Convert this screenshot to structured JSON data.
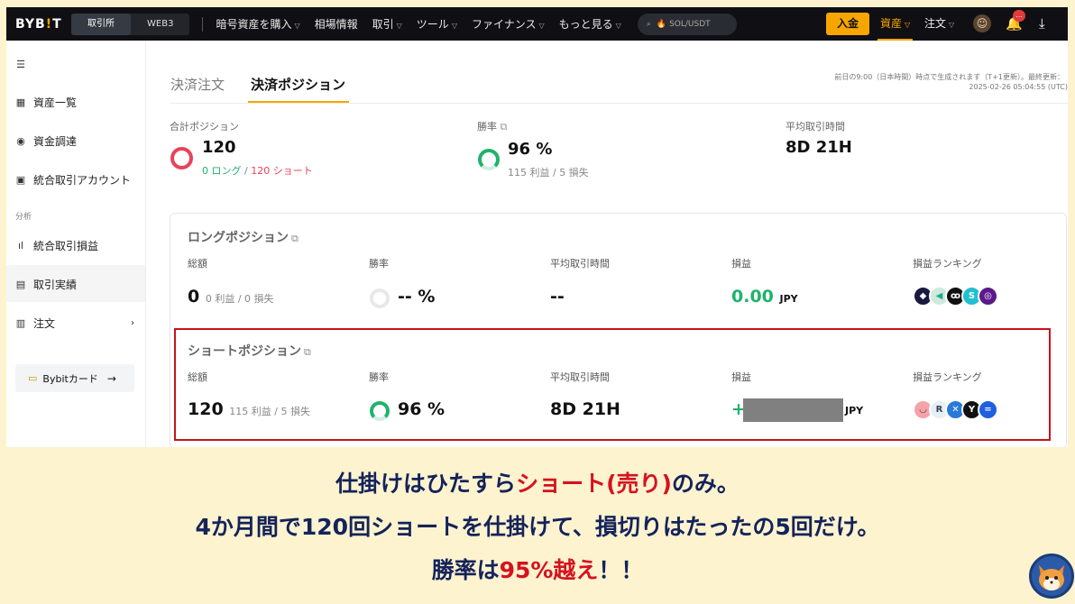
{
  "header": {
    "logo": "BYBIT",
    "seg": [
      "取引所",
      "WEB3"
    ],
    "nav": [
      "暗号資産を購入",
      "相場情報",
      "取引",
      "ツール",
      "ファイナンス",
      "もっと見る"
    ],
    "search_placeholder": "SOL/USDT",
    "deposit": "入金",
    "assets": "資産",
    "orders": "注文",
    "badge": "..."
  },
  "sidebar": {
    "items": [
      "資産一覧",
      "資金調達",
      "統合取引アカウント"
    ],
    "section": "分析",
    "items2": [
      "統合取引損益",
      "取引実績",
      "注文"
    ],
    "card_button": "Bybitカード"
  },
  "tabs": [
    "決済注文",
    "決済ポジション"
  ],
  "update_note": "前日の9:00（日本時間）時点で生成されます（T+1更新）。最終更新：",
  "update_time": "2025-02-26 05:04:55 (UTC)",
  "summary": {
    "total_label": "合計ポジション",
    "total_value": "120",
    "long_part": "0 ロング",
    "short_part": "120 ショート",
    "winrate_label": "勝率",
    "winrate_value": "96 %",
    "winrate_sub": "115 利益 / 5 損失",
    "avg_label": "平均取引時間",
    "avg_value": "8D 21H"
  },
  "long": {
    "title": "ロングポジション",
    "cols": [
      "総額",
      "勝率",
      "平均取引時間",
      "損益",
      "損益ランキング"
    ],
    "total": "0",
    "total_sub": "0 利益 / 0 損失",
    "winrate": "-- %",
    "avg": "--",
    "pnl": "0.00",
    "pnl_unit": "JPY"
  },
  "short": {
    "title": "ショートポジション",
    "cols": [
      "総額",
      "勝率",
      "平均取引時間",
      "損益",
      "損益ランキング"
    ],
    "total": "120",
    "total_sub": "115 利益 / 5 損失",
    "winrate": "96 %",
    "avg": "8D 21H",
    "pnl_sign": "+",
    "pnl_unit": "JPY"
  },
  "caption": {
    "l1a": "仕掛けはひたすら",
    "l1b": "ショート(売り)",
    "l1c": "のみ。",
    "l2": "4か月間で120回ショートを仕掛けて、損切りはたったの5回だけ。",
    "l3a": "勝率は",
    "l3b": "95%越え",
    "l3c": "！！"
  },
  "colors": {
    "accent": "#f7a600",
    "green": "#20b26c",
    "red": "#e94359",
    "highlight_box": "#c8131d",
    "caption_text": "#14235a"
  }
}
